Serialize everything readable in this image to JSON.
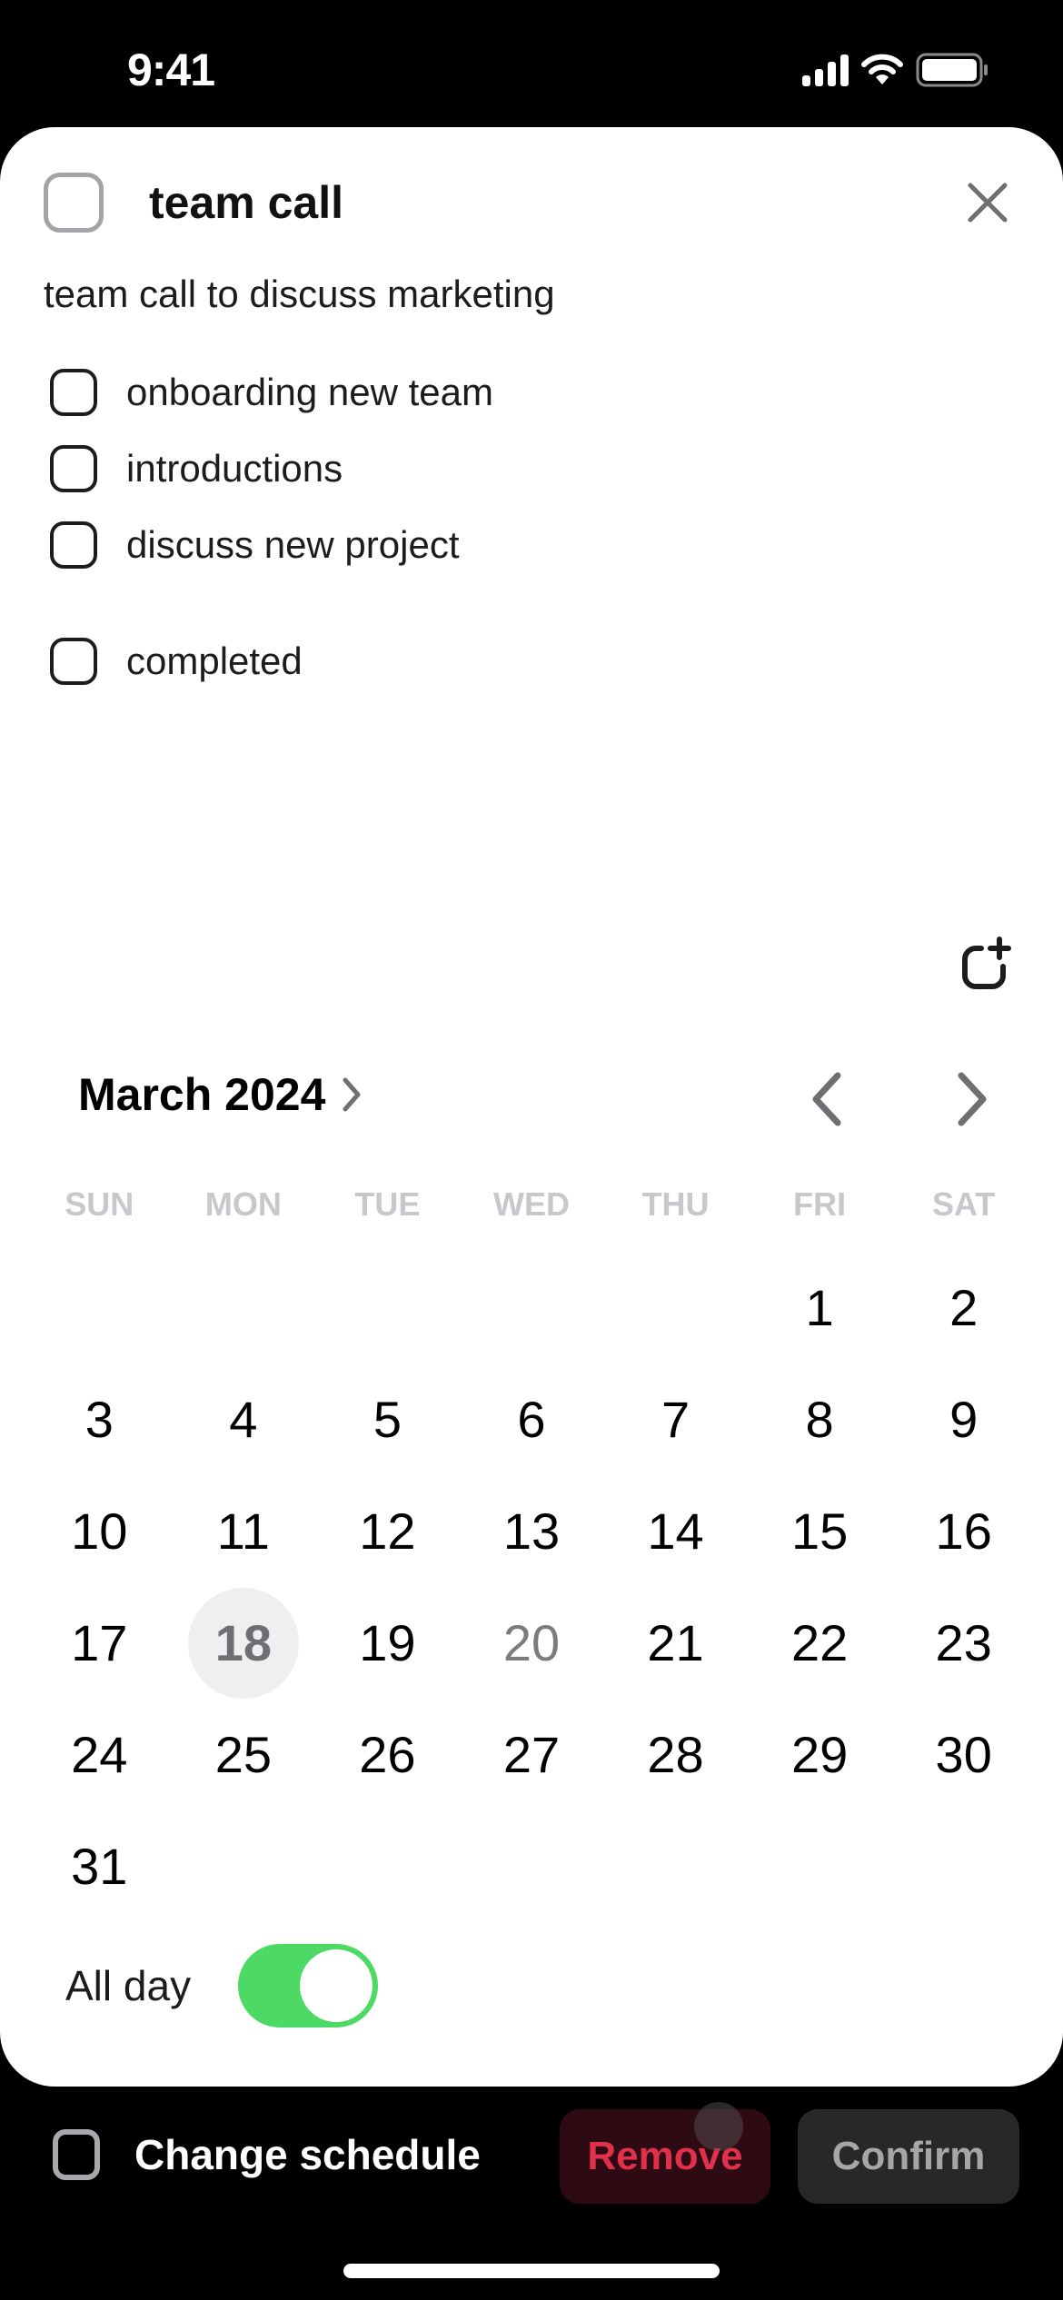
{
  "status_bar": {
    "time": "9:41",
    "icons": [
      "cellular-signal-icon",
      "wifi-icon",
      "battery-icon"
    ]
  },
  "task": {
    "title": "team call",
    "completed": false,
    "description": "team call to discuss marketing",
    "close_icon": "close-icon",
    "subtasks": [
      {
        "label": "onboarding new team",
        "checked": false
      },
      {
        "label": "introductions",
        "checked": false
      },
      {
        "label": "discuss new project",
        "checked": false
      }
    ],
    "completed_item": {
      "label": "completed",
      "checked": false
    },
    "add_icon": "add-subtask-icon"
  },
  "calendar": {
    "month_label": "March 2024",
    "weekdays": [
      "SUN",
      "MON",
      "TUE",
      "WED",
      "THU",
      "FRI",
      "SAT"
    ],
    "leading_blanks": 5,
    "days": [
      "1",
      "2",
      "3",
      "4",
      "5",
      "6",
      "7",
      "8",
      "9",
      "10",
      "11",
      "12",
      "13",
      "14",
      "15",
      "16",
      "17",
      "18",
      "19",
      "20",
      "21",
      "22",
      "23",
      "24",
      "25",
      "26",
      "27",
      "28",
      "29",
      "30",
      "31"
    ],
    "today": "18",
    "muted_days": [
      "20"
    ]
  },
  "all_day": {
    "label": "All day",
    "enabled": true,
    "accent_color": "#4cd964"
  },
  "bottom_bar": {
    "change_schedule_label": "Change schedule",
    "remove_label": "Remove",
    "confirm_label": "Confirm",
    "remove_color": "#e0304b"
  }
}
